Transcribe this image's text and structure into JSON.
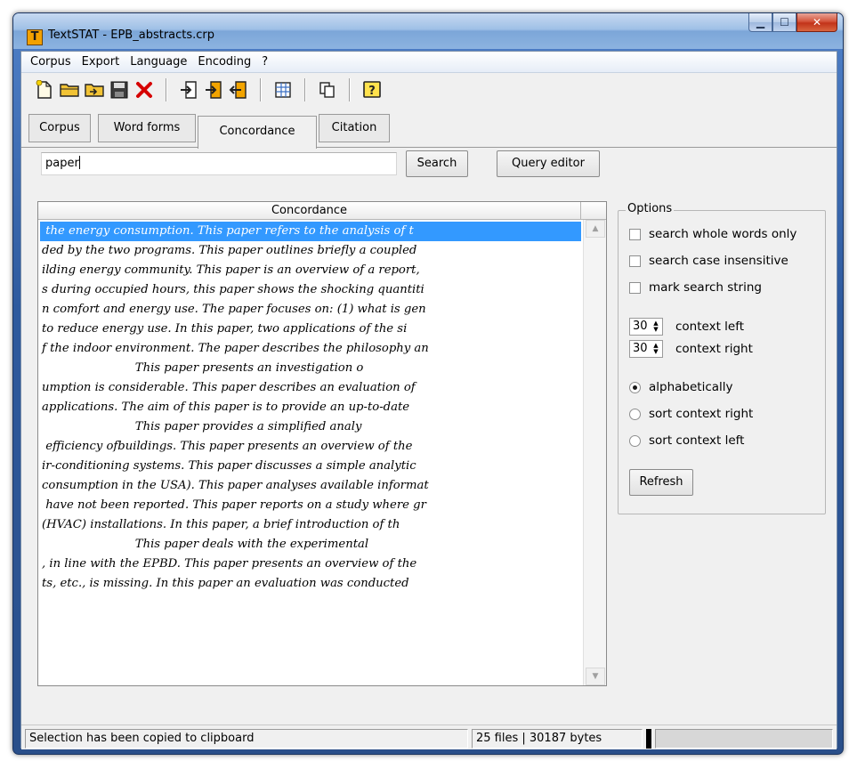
{
  "window": {
    "title": "TextSTAT - EPB_abstracts.crp",
    "app_icon_text": "T",
    "min_symbol": "▁",
    "max_symbol": "☐",
    "close_symbol": "✕"
  },
  "menu": {
    "items": [
      "Corpus",
      "Export",
      "Language",
      "Encoding",
      "?"
    ]
  },
  "toolbar": {
    "icons": [
      "new-file-icon",
      "open-folder-icon",
      "add-folder-icon",
      "save-icon",
      "delete-icon",
      "import-file-icon",
      "import-file-alt-icon",
      "export-file-icon",
      "table-icon",
      "copy-icon",
      "help-icon"
    ]
  },
  "tabs": [
    {
      "label": "Corpus",
      "active": false
    },
    {
      "label": "Word forms",
      "active": false
    },
    {
      "label": "Concordance",
      "active": true
    },
    {
      "label": "Citation",
      "active": false
    }
  ],
  "search": {
    "value": "paper",
    "search_label": "Search",
    "query_editor_label": "Query editor"
  },
  "concordance": {
    "header": "Concordance",
    "selected_index": 0,
    "rows": [
      " the energy consumption. This paper refers to the analysis of t",
      "ded by the two programs. This paper outlines briefly a coupled",
      "ilding energy community. This paper is an overview of a report,",
      "s during occupied hours, this paper shows the shocking quantiti",
      "n comfort and energy use. The paper focuses on: (1) what is gen",
      "to reduce energy use. In this paper, two applications of the si",
      "f the indoor environment. The paper describes the philosophy an",
      "                         This paper presents an investigation o",
      "umption is considerable. This paper describes an evaluation of",
      "applications. The aim of this paper is to provide an up-to-date",
      "                         This paper provides a simplified analy",
      " efficiency ofbuildings. This paper presents an overview of the",
      "ir-conditioning systems. This paper discusses a simple analytic",
      "consumption in the USA). This paper analyses available informat",
      " have not been reported. This paper reports on a study where gr",
      "(HVAC) installations. In this paper, a brief introduction of th",
      "                         This paper deals with the experimental",
      ", in line with the EPBD. This paper presents an overview of the",
      "ts, etc., is missing. In this paper an evaluation was conducted"
    ]
  },
  "options": {
    "legend": "Options",
    "whole_words": {
      "label": "search whole words only",
      "checked": false
    },
    "case_insensitive": {
      "label": "search case insensitive",
      "checked": false
    },
    "mark_string": {
      "label": "mark search string",
      "checked": false
    },
    "context_left": {
      "value": "30",
      "label": "context left"
    },
    "context_right": {
      "value": "30",
      "label": "context right"
    },
    "sort": {
      "alphabetically": {
        "label": "alphabetically",
        "selected": true
      },
      "context_right": {
        "label": "sort context right",
        "selected": false
      },
      "context_left": {
        "label": "sort context left",
        "selected": false
      }
    },
    "refresh_label": "Refresh"
  },
  "status": {
    "message": "Selection has been copied to clipboard",
    "files_info": "25 files | 30187 bytes"
  }
}
